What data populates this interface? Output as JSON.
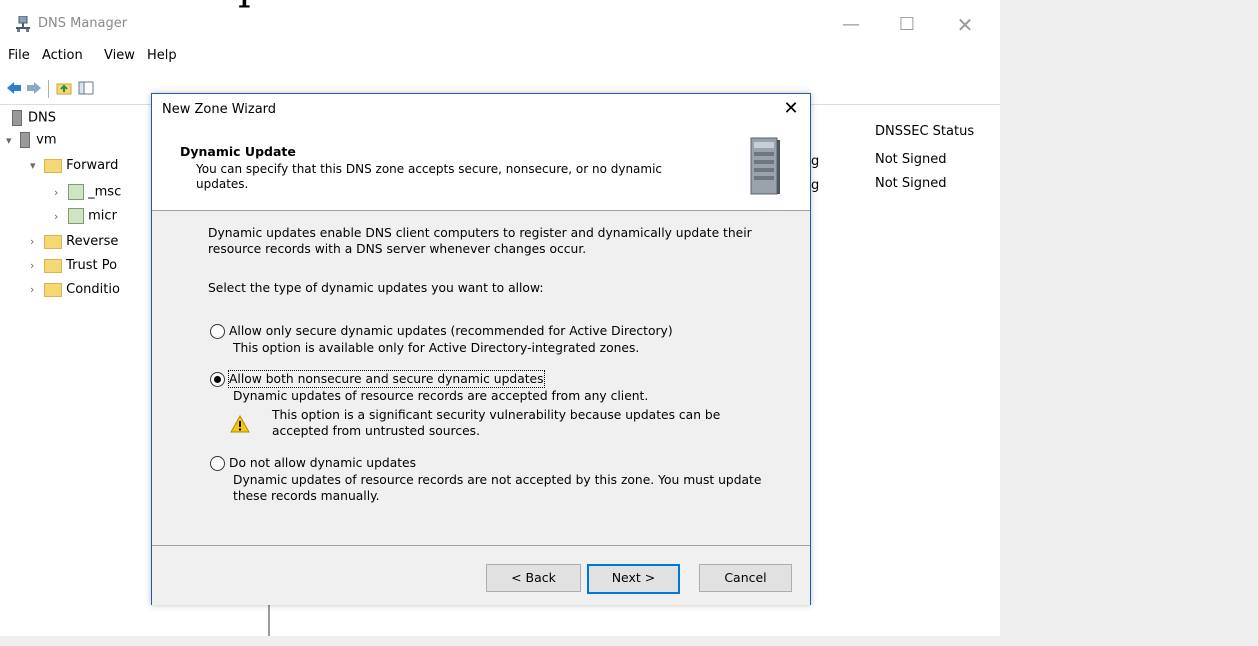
{
  "crop_text": "p",
  "window": {
    "title": "DNS Manager",
    "controls": {
      "minimize": "—",
      "maximize": "☐",
      "close": "✕"
    }
  },
  "menu": [
    "File",
    "Action",
    "View",
    "Help"
  ],
  "tree": {
    "root": "DNS",
    "server": "vm",
    "forward": "Forward",
    "zones": [
      "_msc",
      "micr"
    ],
    "others": [
      "Reverse",
      "Trust Po",
      "Conditio"
    ]
  },
  "right_pane": {
    "column_header": "DNSSEC Status",
    "rows": [
      {
        "partial": "g",
        "status": "Not Signed"
      },
      {
        "partial": "g",
        "status": "Not Signed"
      }
    ]
  },
  "dialog": {
    "title": "New Zone Wizard",
    "close": "✕",
    "heading": "Dynamic Update",
    "subheading_line1": "You can specify that this DNS zone accepts secure, nonsecure, or no dynamic",
    "subheading_line2": "updates.",
    "intro_line1": "Dynamic updates enable DNS client computers to register and dynamically update their",
    "intro_line2": "resource records with a DNS server whenever changes occur.",
    "prompt": "Select the type of dynamic updates you want to allow:",
    "options": [
      {
        "label": "Allow only secure dynamic updates (recommended for Active Directory)",
        "desc": "This option is available only for Active Directory-integrated zones.",
        "selected": false
      },
      {
        "label": "Allow both nonsecure and secure dynamic updates",
        "desc": "Dynamic updates of resource records are accepted from any client.",
        "warning_line1": "This option is a significant security vulnerability because updates can be",
        "warning_line2": "accepted from untrusted sources.",
        "selected": true
      },
      {
        "label": "Do not allow dynamic updates",
        "desc_line1": "Dynamic updates of resource records are not accepted by this zone. You must update",
        "desc_line2": "these records manually.",
        "selected": false
      }
    ],
    "buttons": {
      "back": "< Back",
      "next": "Next >",
      "cancel": "Cancel"
    }
  },
  "colors": {
    "accent": "#0078d7",
    "dialog_border": "#1c5fa8",
    "folder": "#f5d776",
    "warning": "#f2c811"
  }
}
